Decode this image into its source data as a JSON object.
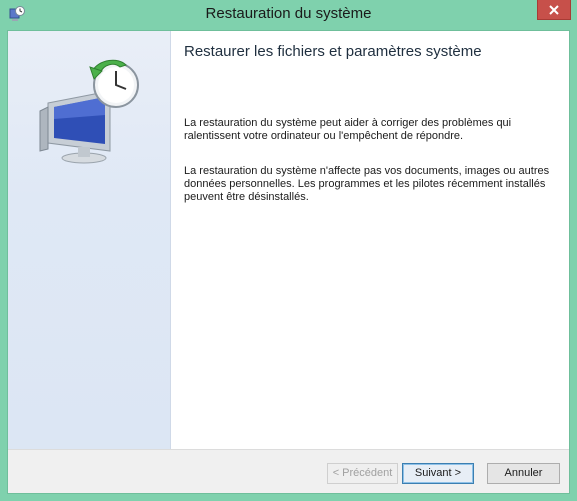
{
  "window": {
    "title": "Restauration du système",
    "app_icon": "system-restore-icon",
    "close_icon": "close-icon"
  },
  "main": {
    "heading": "Restaurer les fichiers et paramètres système",
    "paragraph1": "La restauration du système peut aider à corriger des problèmes qui ralentissent votre ordinateur ou l'empêchent de répondre.",
    "paragraph2": "La restauration du système n'affecte pas vos documents, images ou autres données personnelles. Les programmes et les pilotes récemment installés peuvent être désinstallés."
  },
  "buttons": {
    "previous": "< Précédent",
    "next": "Suivant >",
    "cancel": "Annuler"
  },
  "colors": {
    "titlebar": "#7fd1ad",
    "close_button": "#c7504a",
    "left_panel": "#dce6f4"
  }
}
